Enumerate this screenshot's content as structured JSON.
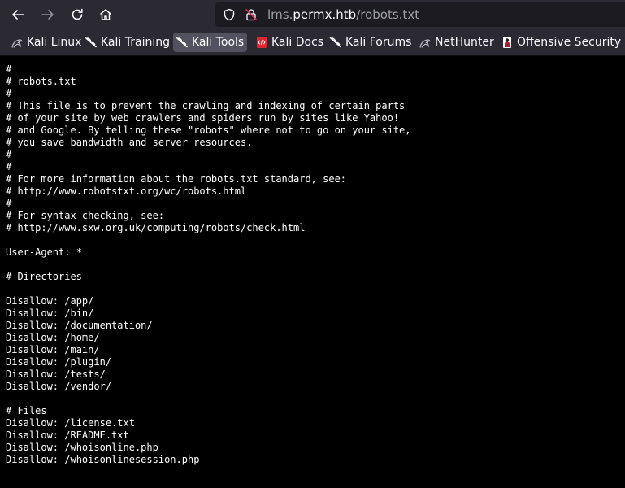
{
  "browser": {
    "nav": {
      "back_icon": "arrow-left-icon",
      "forward_icon": "arrow-right-icon",
      "reload_icon": "reload-icon",
      "home_icon": "home-icon"
    },
    "urlbar": {
      "host_prefix": "lms.",
      "host_domain": "permx.htb",
      "path": "/robots.txt"
    },
    "bookmarks": [
      {
        "label": "Kali Linux",
        "icon": "kali-dragon-icon"
      },
      {
        "label": "Kali Training",
        "icon": "kali-dragon-icon"
      },
      {
        "label": "Kali Tools",
        "icon": "kali-dragon-icon"
      },
      {
        "label": "Kali Docs",
        "icon": "kali-docs-icon"
      },
      {
        "label": "Kali Forums",
        "icon": "kali-dragon-icon"
      },
      {
        "label": "NetHunter",
        "icon": "nethunter-icon"
      },
      {
        "label": "Offensive Security",
        "icon": "offsec-icon"
      }
    ],
    "colors": {
      "toolbar": "#2b2a33",
      "urlbar": "#1c1b22",
      "active_bookmark": "#52525e",
      "page_background": "#000000",
      "page_text": "#ffffff",
      "kali_docs_red": "#e3252f"
    }
  },
  "page": {
    "robots_txt": "#\n# robots.txt\n#\n# This file is to prevent the crawling and indexing of certain parts\n# of your site by web crawlers and spiders run by sites like Yahoo!\n# and Google. By telling these \"robots\" where not to go on your site,\n# you save bandwidth and server resources.\n#\n#\n# For more information about the robots.txt standard, see:\n# http://www.robotstxt.org/wc/robots.html\n#\n# For syntax checking, see:\n# http://www.sxw.org.uk/computing/robots/check.html\n\nUser-Agent: *\n\n# Directories\n\nDisallow: /app/\nDisallow: /bin/\nDisallow: /documentation/\nDisallow: /home/\nDisallow: /main/\nDisallow: /plugin/\nDisallow: /tests/\nDisallow: /vendor/\n\n# Files\nDisallow: /license.txt\nDisallow: /README.txt\nDisallow: /whoisonline.php\nDisallow: /whoisonlinesession.php"
  }
}
